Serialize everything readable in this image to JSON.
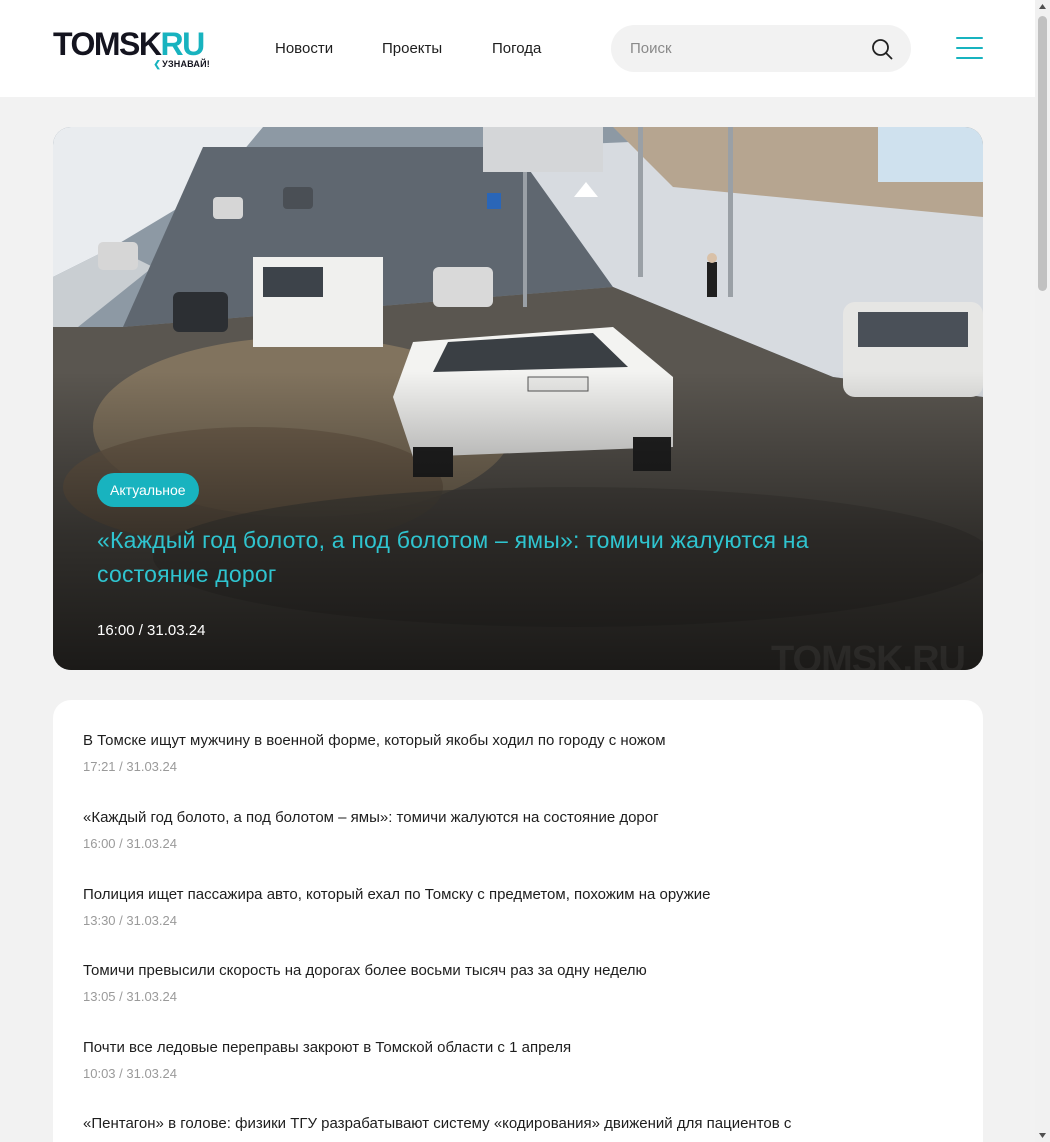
{
  "header": {
    "logo": {
      "main": "TOMSK",
      "accent": "RU",
      "sub": "УЗНАВАЙ!"
    },
    "nav": [
      {
        "label": "Новости"
      },
      {
        "label": "Проекты"
      },
      {
        "label": "Погода"
      }
    ],
    "search": {
      "placeholder": "Поиск",
      "value": ""
    },
    "accent_color": "#18b3bf",
    "menu_icon": "hamburger-icon"
  },
  "hero": {
    "badge": "Актуальное",
    "title": "«Каждый год болото, а под болотом – ямы»: томичи жалуются на состояние дорог",
    "date": "16:00 / 31.03.24",
    "watermark": "TOMSK.RU",
    "image_description_icon": "photo"
  },
  "news": [
    {
      "title": "В Томске ищут мужчину в военной форме, который якобы ходил по городу с ножом",
      "date": "17:21 / 31.03.24"
    },
    {
      "title": "«Каждый год болото, а под болотом – ямы»: томичи жалуются на состояние дорог",
      "date": "16:00 / 31.03.24"
    },
    {
      "title": "Полиция ищет пассажира авто, который ехал по Томску с предметом, похожим на оружие",
      "date": "13:30 / 31.03.24"
    },
    {
      "title": "Томичи превысили скорость на дорогах более восьми тысяч раз за одну неделю",
      "date": "13:05 / 31.03.24"
    },
    {
      "title": "Почти все ледовые переправы закроют в Томской области с 1 апреля",
      "date": "10:03 / 31.03.24"
    },
    {
      "title": "«Пентагон» в голове: физики ТГУ разрабатывают систему «кодирования» движений для  пациентов с",
      "date": ""
    }
  ]
}
